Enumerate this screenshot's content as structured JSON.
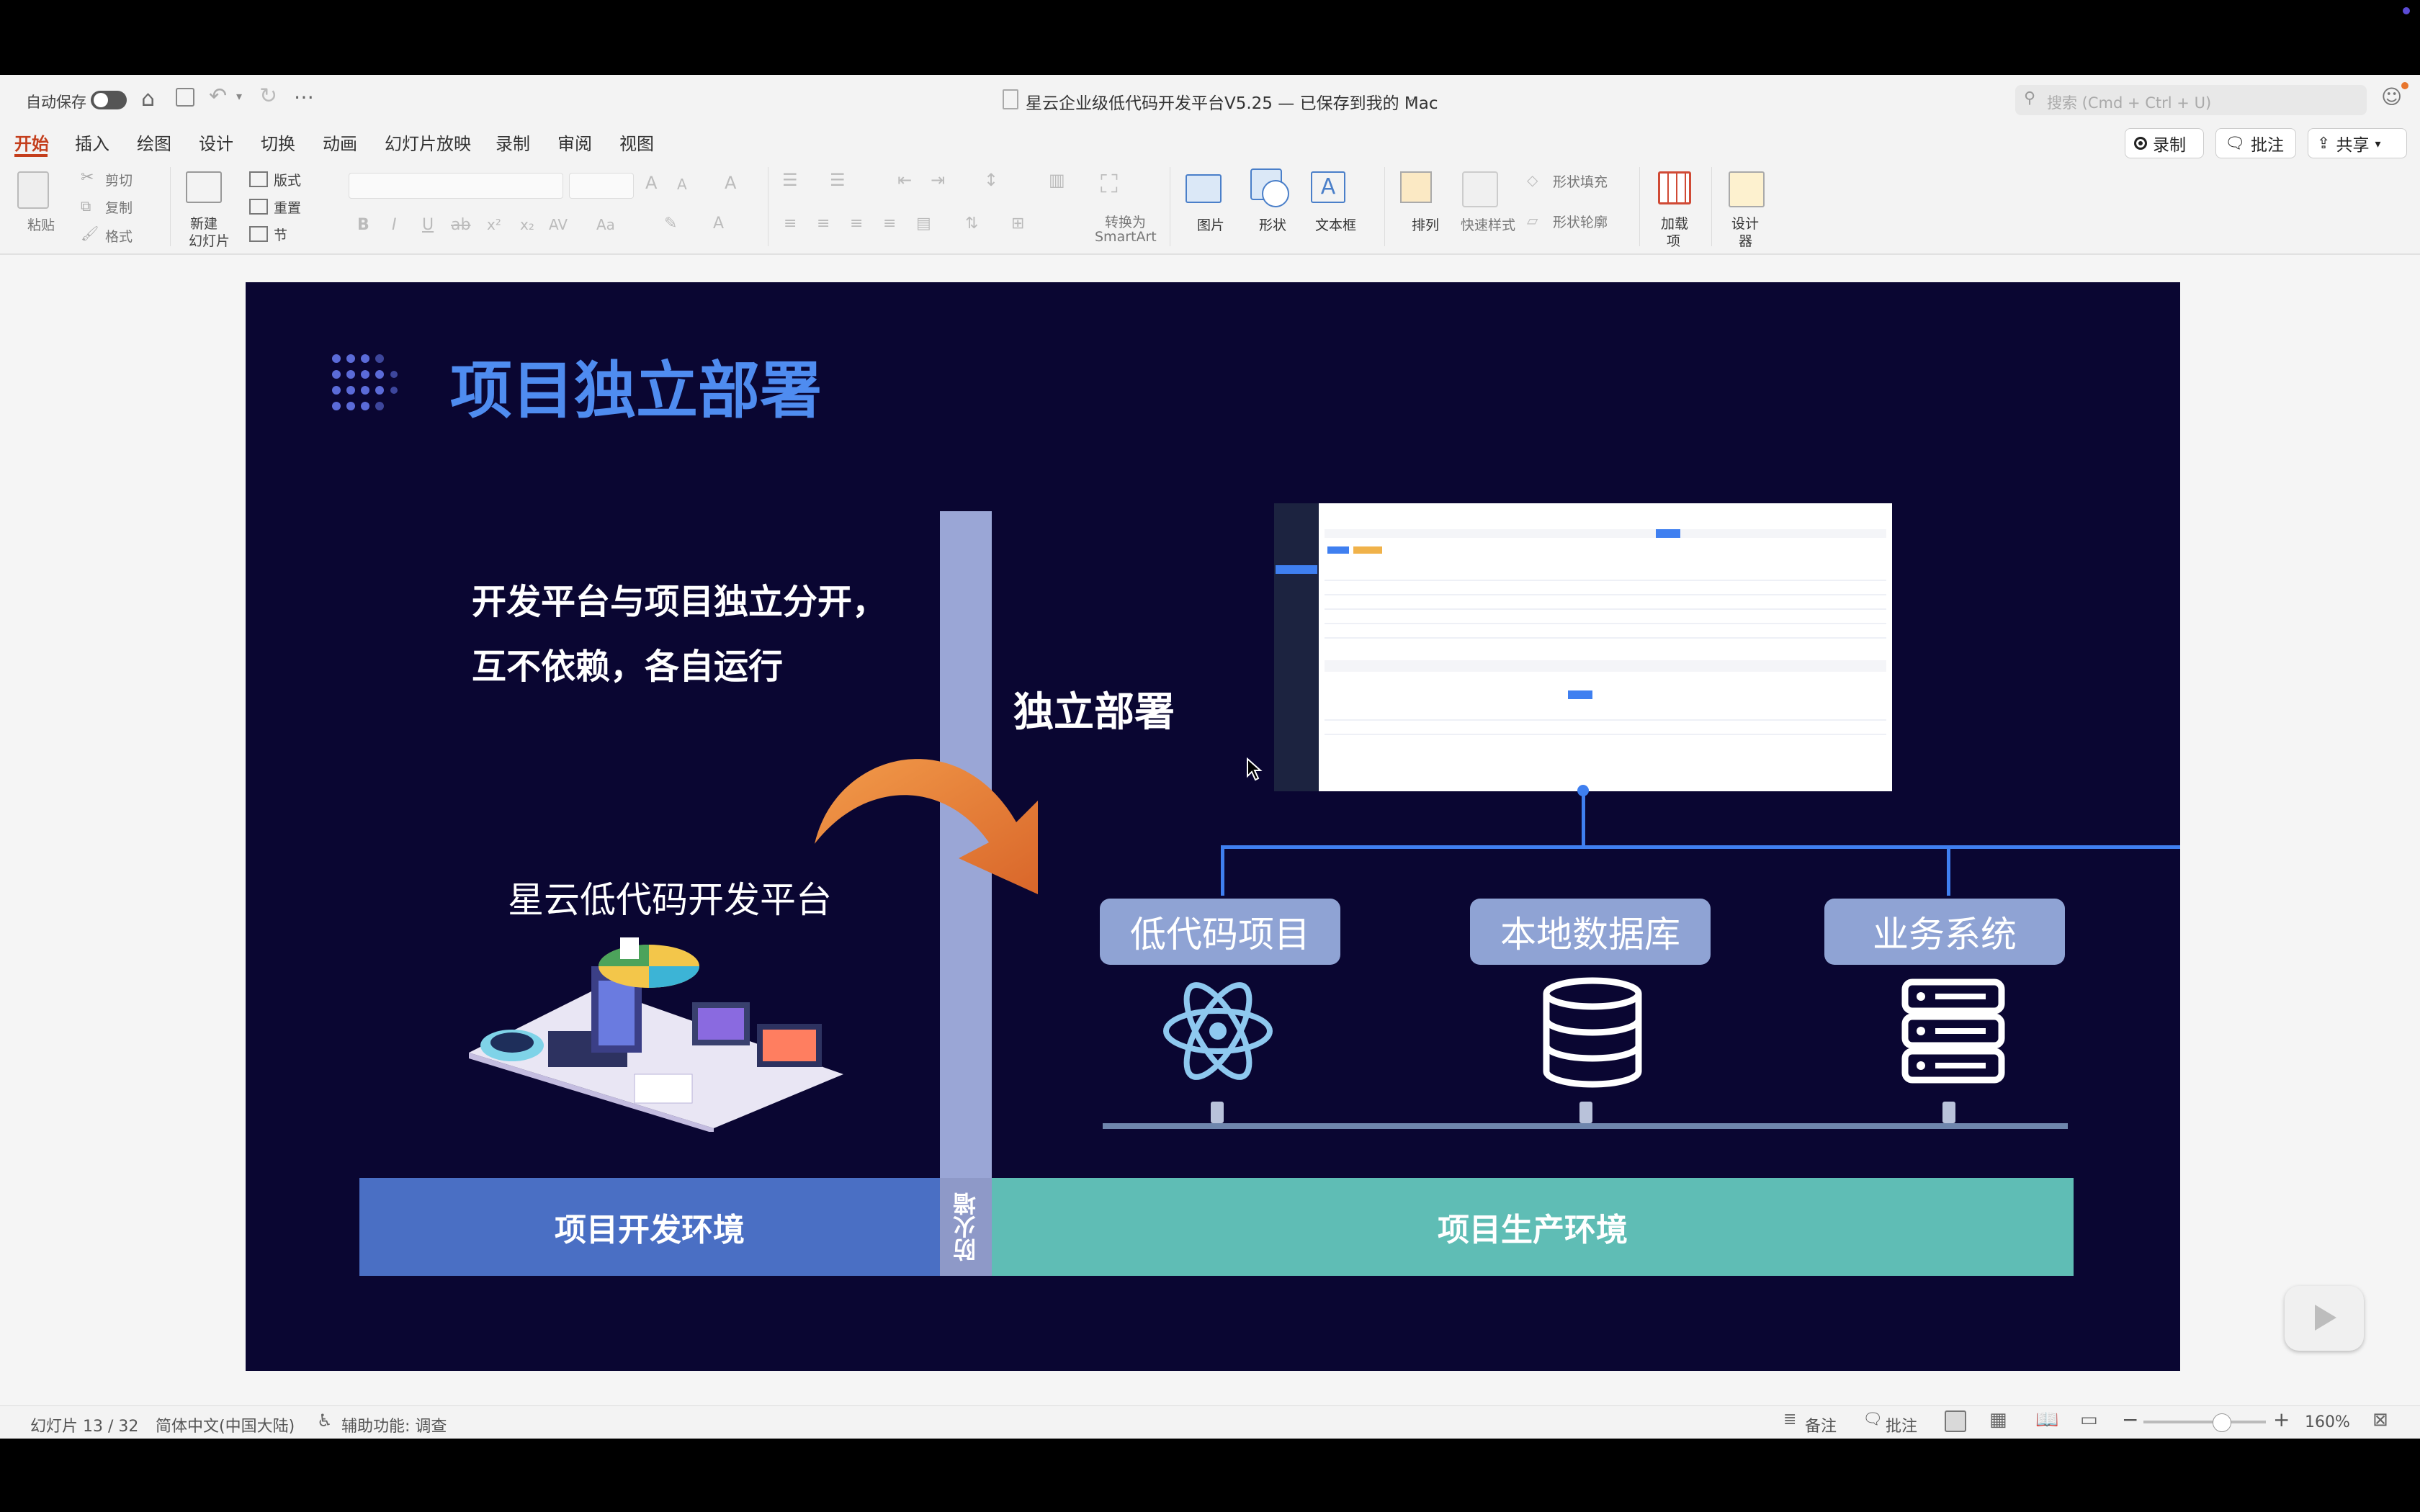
{
  "window": {
    "autosave_label": "自动保存",
    "title": "星云企业级低代码开发平台V5.25 — 已保存到我的 Mac",
    "search_placeholder": "搜索 (Cmd + Ctrl + U)"
  },
  "ribbon_tabs": [
    "开始",
    "插入",
    "绘图",
    "设计",
    "切换",
    "动画",
    "幻灯片放映",
    "录制",
    "审阅",
    "视图"
  ],
  "right_buttons": {
    "record": "录制",
    "comment": "批注",
    "share": "共享"
  },
  "ribbon": {
    "paste": "粘贴",
    "cut": "剪切",
    "copy": "复制",
    "format": "格式",
    "new_slide_1": "新建",
    "new_slide_2": "幻灯片",
    "layout": "版式",
    "reset": "重置",
    "section": "节",
    "convert_1": "转换为",
    "convert_2": "SmartArt",
    "picture": "图片",
    "shape": "形状",
    "textbox": "文本框",
    "arrange": "排列",
    "quick_styles": "快速样式",
    "shape_fill": "形状填充",
    "shape_outline": "形状轮廓",
    "addins_1": "加载",
    "addins_2": "项",
    "designer_1": "设计",
    "designer_2": "器"
  },
  "slide": {
    "title": "项目独立部署",
    "statement_line1": "开发平台与项目独立分开，",
    "statement_line2": "互不依赖，各自运行",
    "platform_name": "星云低代码开发平台",
    "deploy_label": "独立部署",
    "firewall": "防火墙",
    "node1": "低代码项目",
    "node2": "本地数据库",
    "node3": "业务系统",
    "dev_env": "项目开发环境",
    "prod_env": "项目生产环境",
    "colors": {
      "bg": "#0a0632",
      "title": "#4f8cf0",
      "pill": "#8fa3d4",
      "dev_bar": "#4a6fc4",
      "prod_bar": "#5fbdb5",
      "line": "#3f7ff0",
      "arrow": "#e97b33"
    }
  },
  "status": {
    "slide_counter": "幻灯片 13 / 32",
    "language": "简体中文(中国大陆)",
    "accessibility": "辅助功能: 调查",
    "notes": "备注",
    "comments": "批注",
    "zoom": "160%"
  }
}
